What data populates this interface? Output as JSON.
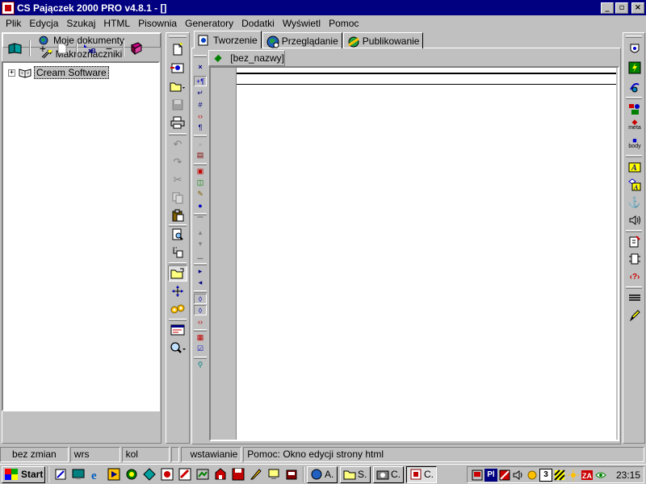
{
  "window": {
    "title": "CS Pajączek 2000 PRO v4.8.1 - []",
    "minimize": "_",
    "maximize": "▫",
    "close": "×"
  },
  "menu": [
    "Plik",
    "Edycja",
    "Szukaj",
    "HTML",
    "Pisownia",
    "Generatory",
    "Dodatki",
    "Wyświetl",
    "Pomoc"
  ],
  "left_panel": {
    "tabs": [
      "Moje dokumenty",
      "Makroznaczniki"
    ],
    "tree": {
      "expander": "+",
      "items": [
        "Cream Software"
      ]
    }
  },
  "main_tabs": [
    "Tworzenie",
    "Przeglądanie",
    "Publikowanie"
  ],
  "document_tab": "[bez_nazwy]",
  "status_bar": [
    "bez zmian",
    "wrs",
    "kol",
    "",
    "wstawianie",
    "Pomoc: Okno edycji strony html"
  ],
  "right_toolbar_labels": {
    "meta": "meta",
    "body": "body"
  },
  "taskbar": {
    "start": "Start",
    "tasks": [
      "A.",
      "S.",
      "C.",
      "C."
    ],
    "tray_text": [
      "Pl",
      "3"
    ],
    "clock": "23:15"
  }
}
